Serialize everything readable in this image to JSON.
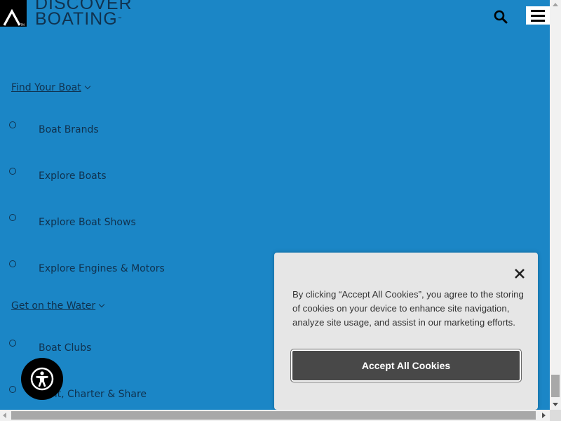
{
  "header": {
    "logo_line1": "DISCOVER",
    "logo_line2": "BOATING",
    "logo_tm": "™",
    "search_icon": "search-icon",
    "menu_icon": "hamburger-menu-icon"
  },
  "nav": {
    "sections": [
      {
        "heading": "Find Your Boat",
        "items": [
          "Boat Brands",
          "Explore Boats",
          "Explore Boat Shows",
          "Explore Engines & Motors"
        ]
      },
      {
        "heading": "Get on the Water",
        "items": [
          "Boat Clubs",
          "Rent, Charter & Share"
        ]
      }
    ]
  },
  "cookie_banner": {
    "text": "By clicking “Accept All Cookies”, you agree to the storing of cookies on your device to enhance site navigation, analyze site usage, and assist in our marketing efforts.",
    "accept_label": "Accept All Cookies",
    "close_icon": "close-icon"
  },
  "accessibility": {
    "icon": "accessibility-icon"
  },
  "colors": {
    "page_background": "#1b86c6",
    "nav_text": "#10324f",
    "banner_background": "#e6e6e6",
    "accept_button": "#484848"
  }
}
